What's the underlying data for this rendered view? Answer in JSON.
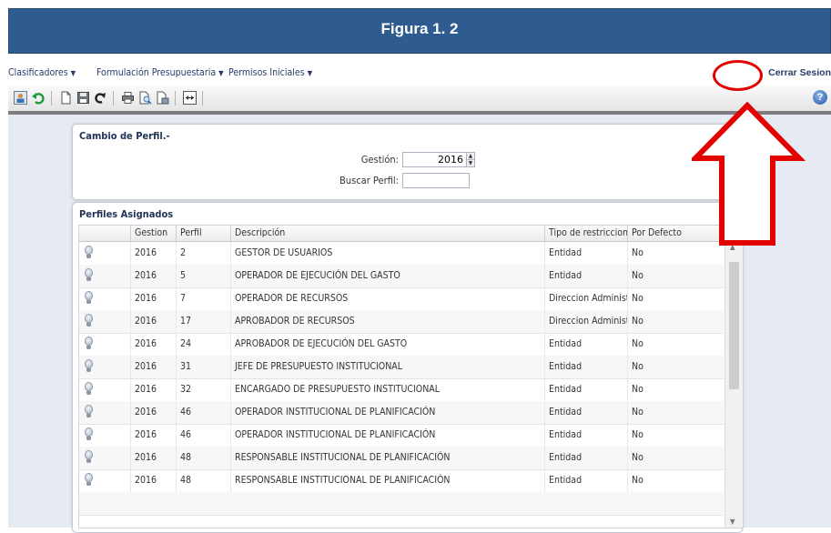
{
  "banner": {
    "title": "Figura 1. 2"
  },
  "menu": {
    "items": [
      "Clasificadores",
      "Formulación Presupuestaria",
      "Permisos Iniciales"
    ],
    "logout": "Cerrar Sesion"
  },
  "toolbar": {
    "icons": [
      "user-profile-icon",
      "undo-icon",
      "new-document-icon",
      "save-icon",
      "refresh-icon",
      "print-icon",
      "print-preview-icon",
      "export-icon",
      "expand-icon"
    ],
    "help": "?"
  },
  "profile_change": {
    "title": "Cambio de Perfil.-",
    "gestion_label": "Gestión:",
    "gestion_value": "2016",
    "search_label": "Buscar Perfil:",
    "search_value": ""
  },
  "assigned": {
    "title": "Perfiles Asignados",
    "columns": [
      "Gestion",
      "Perfil",
      "Descripción",
      "Tipo de restriccion",
      "Por Defecto"
    ],
    "rows": [
      [
        "2016",
        "2",
        "GESTOR DE USUARIOS",
        "Entidad",
        "No"
      ],
      [
        "2016",
        "5",
        "OPERADOR DE EJECUCIÓN DEL GASTO",
        "Entidad",
        "No"
      ],
      [
        "2016",
        "7",
        "OPERADOR DE RECURSOS",
        "Direccion Administ...",
        "No"
      ],
      [
        "2016",
        "17",
        "APROBADOR DE RECURSOS",
        "Direccion Administ...",
        "No"
      ],
      [
        "2016",
        "24",
        "APROBADOR DE EJECUCIÓN DEL GASTO",
        "Entidad",
        "No"
      ],
      [
        "2016",
        "31",
        "JEFE DE PRESUPUESTO INSTITUCIONAL",
        "Entidad",
        "No"
      ],
      [
        "2016",
        "32",
        "ENCARGADO DE PRESUPUESTO INSTITUCIONAL",
        "Entidad",
        "No"
      ],
      [
        "2016",
        "46",
        "OPERADOR INSTITUCIONAL DE PLANIFICACIÓN",
        "Entidad",
        "No"
      ],
      [
        "2016",
        "46",
        "OPERADOR INSTITUCIONAL DE PLANIFICACIÓN",
        "Entidad",
        "No"
      ],
      [
        "2016",
        "48",
        "RESPONSABLE INSTITUCIONAL DE PLANIFICACIÓN",
        "Entidad",
        "No"
      ],
      [
        "2016",
        "48",
        "RESPONSABLE INSTITUCIONAL DE PLANIFICACIÓN",
        "Entidad",
        "No"
      ]
    ]
  },
  "colors": {
    "banner": "#2e5c91",
    "annotation": "#e30000",
    "background": "#e6ebf3"
  }
}
